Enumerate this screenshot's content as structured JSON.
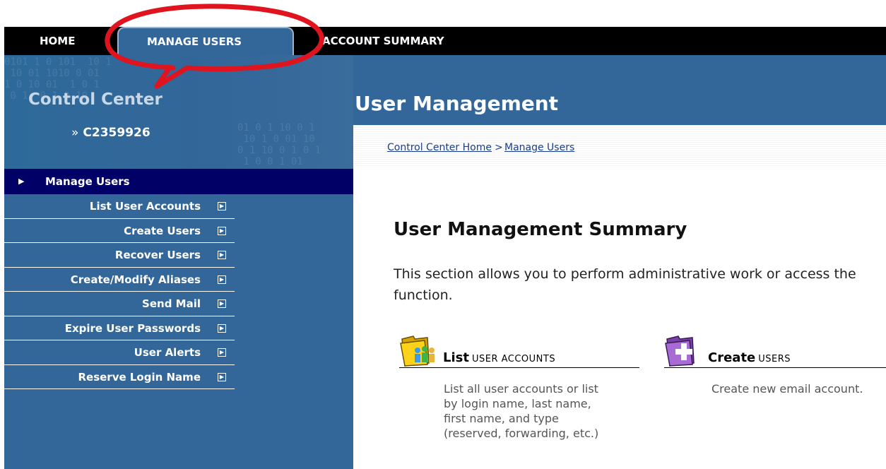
{
  "nav": {
    "home": "HOME",
    "manage_users": "MANAGE USERS",
    "account_summary": "ACCOUNT SUMMARY"
  },
  "sidebar": {
    "title": "Control Center",
    "account_id": "C2359926",
    "account_prefix": "»",
    "section_label": "Manage Users",
    "items": [
      {
        "label": "List User Accounts"
      },
      {
        "label": "Create Users"
      },
      {
        "label": "Recover Users"
      },
      {
        "label": "Create/Modify Aliases"
      },
      {
        "label": "Send Mail"
      },
      {
        "label": "Expire User Passwords"
      },
      {
        "label": "User Alerts"
      },
      {
        "label": "Reserve Login Name"
      }
    ]
  },
  "main": {
    "title": "User Management",
    "breadcrumb": {
      "home": "Control Center Home",
      "separator": ">",
      "current": "Manage Users"
    },
    "summary_title": "User Management Summary",
    "summary_desc": "This section allows you to perform administrative work or access the function.",
    "features": [
      {
        "title_main": "List",
        "title_small": "USER ACCOUNTS",
        "desc": "List all user accounts or list by login name, last name, first name, and type (reserved, forwarding, etc.)",
        "icon": "folder-users-icon"
      },
      {
        "title_main": "Create",
        "title_small": "USERS",
        "desc": "Create new email account.",
        "icon": "folder-add-icon"
      }
    ]
  },
  "colors": {
    "nav_bg": "#000000",
    "panel_blue": "#336699",
    "menu_head": "#000066",
    "link": "#1a3f8a",
    "annotation_red": "#e0141e"
  }
}
